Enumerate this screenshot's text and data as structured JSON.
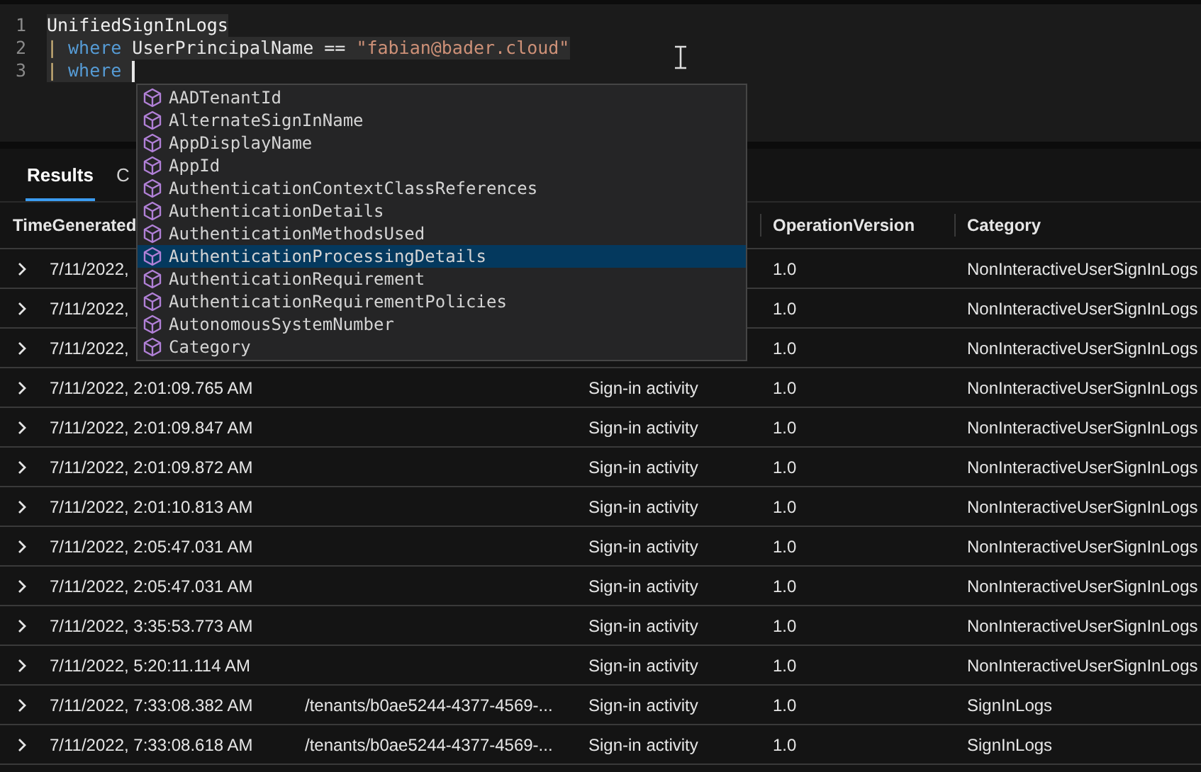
{
  "editor": {
    "lines": [
      {
        "number": "1",
        "highlighted": true,
        "tokens": [
          {
            "kind": "table",
            "text": "UnifiedSignInLogs"
          }
        ]
      },
      {
        "number": "2",
        "highlighted": true,
        "tokens": [
          {
            "kind": "pipe",
            "text": "|"
          },
          {
            "kind": "keyword",
            "text": "where"
          },
          {
            "kind": "plain",
            "text": "UserPrincipalName =="
          },
          {
            "kind": "string",
            "text": "\"fabian@bader.cloud\""
          }
        ]
      },
      {
        "number": "3",
        "highlighted": true,
        "cursor": true,
        "tokens": [
          {
            "kind": "pipe",
            "text": "|"
          },
          {
            "kind": "keyword",
            "text": "where"
          }
        ]
      }
    ]
  },
  "suggestions": [
    {
      "label": "AADTenantId",
      "selected": false
    },
    {
      "label": "AlternateSignInName",
      "selected": false
    },
    {
      "label": "AppDisplayName",
      "selected": false
    },
    {
      "label": "AppId",
      "selected": false
    },
    {
      "label": "AuthenticationContextClassReferences",
      "selected": false
    },
    {
      "label": "AuthenticationDetails",
      "selected": false
    },
    {
      "label": "AuthenticationMethodsUsed",
      "selected": false
    },
    {
      "label": "AuthenticationProcessingDetails",
      "selected": true
    },
    {
      "label": "AuthenticationRequirement",
      "selected": false
    },
    {
      "label": "AuthenticationRequirementPolicies",
      "selected": false
    },
    {
      "label": "AutonomousSystemNumber",
      "selected": false
    },
    {
      "label": "Category",
      "selected": false
    }
  ],
  "tabs": [
    {
      "label": "Results",
      "selected": true
    },
    {
      "label": "C",
      "selected": false
    }
  ],
  "table": {
    "columns": [
      {
        "label": "TimeGenerated"
      },
      {},
      {},
      {
        "label": "OperationVersion"
      },
      {
        "label": "Category"
      }
    ],
    "rows": [
      [
        "7/11/2022,",
        null,
        null,
        "1.0",
        "NonInteractiveUserSignInLogs"
      ],
      [
        "7/11/2022,",
        null,
        null,
        "1.0",
        "NonInteractiveUserSignInLogs"
      ],
      [
        "7/11/2022,",
        null,
        null,
        "1.0",
        "NonInteractiveUserSignInLogs"
      ],
      [
        "7/11/2022, 2:01:09.765 AM",
        null,
        "Sign-in activity",
        "1.0",
        "NonInteractiveUserSignInLogs"
      ],
      [
        "7/11/2022, 2:01:09.847 AM",
        null,
        "Sign-in activity",
        "1.0",
        "NonInteractiveUserSignInLogs"
      ],
      [
        "7/11/2022, 2:01:09.872 AM",
        null,
        "Sign-in activity",
        "1.0",
        "NonInteractiveUserSignInLogs"
      ],
      [
        "7/11/2022, 2:01:10.813 AM",
        null,
        "Sign-in activity",
        "1.0",
        "NonInteractiveUserSignInLogs"
      ],
      [
        "7/11/2022, 2:05:47.031 AM",
        null,
        "Sign-in activity",
        "1.0",
        "NonInteractiveUserSignInLogs"
      ],
      [
        "7/11/2022, 2:05:47.031 AM",
        null,
        "Sign-in activity",
        "1.0",
        "NonInteractiveUserSignInLogs"
      ],
      [
        "7/11/2022, 3:35:53.773 AM",
        null,
        "Sign-in activity",
        "1.0",
        "NonInteractiveUserSignInLogs"
      ],
      [
        "7/11/2022, 5:20:11.114 AM",
        null,
        "Sign-in activity",
        "1.0",
        "NonInteractiveUserSignInLogs"
      ],
      [
        "7/11/2022, 7:33:08.382 AM",
        "/tenants/b0ae5244-4377-4569-...",
        "Sign-in activity",
        "1.0",
        "SignInLogs"
      ],
      [
        "7/11/2022, 7:33:08.618 AM",
        "/tenants/b0ae5244-4377-4569-...",
        "Sign-in activity",
        "1.0",
        "SignInLogs"
      ]
    ]
  }
}
